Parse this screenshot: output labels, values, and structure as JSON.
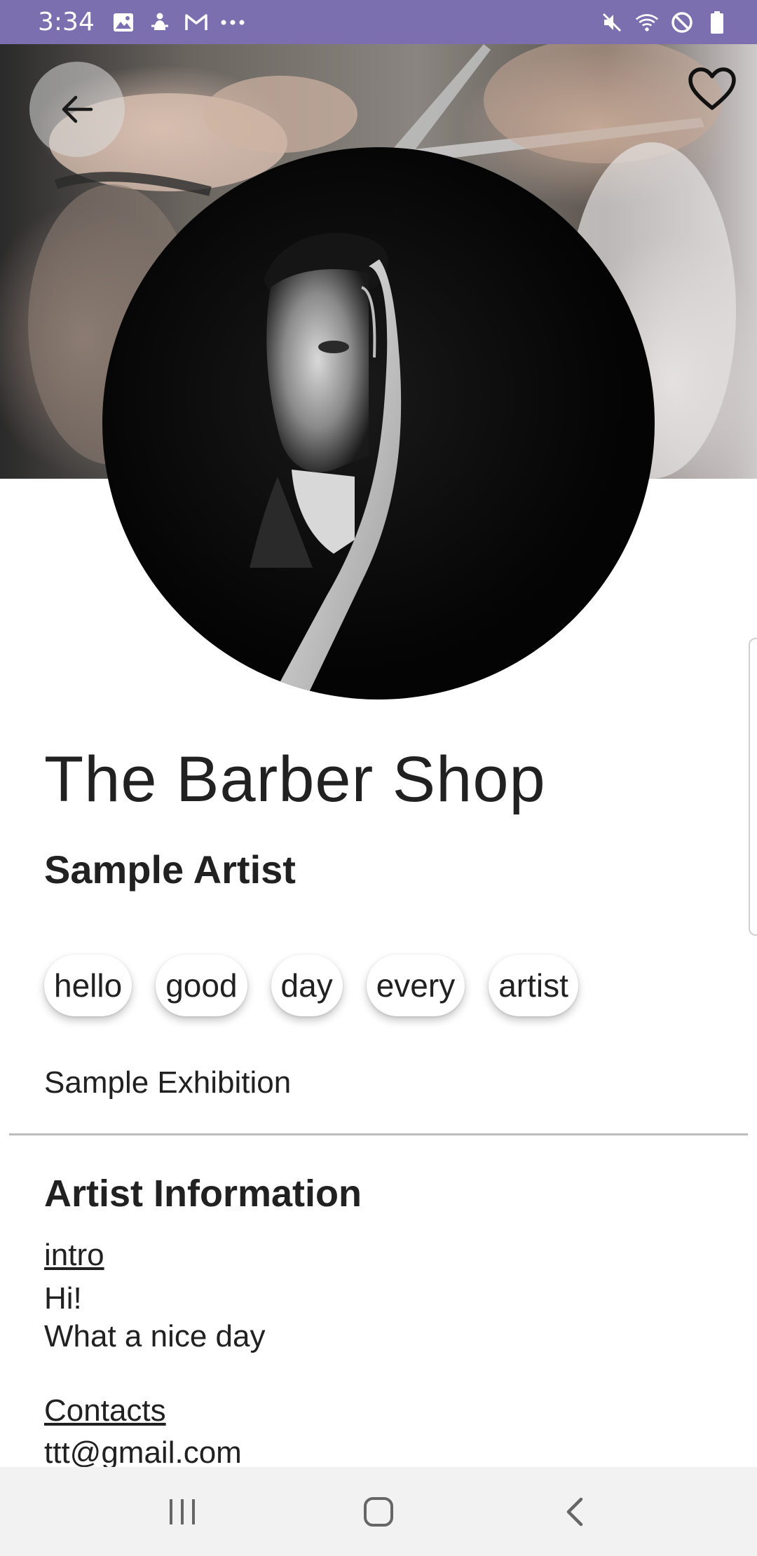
{
  "status_bar": {
    "time": "3:34",
    "left_icons": [
      "image-icon",
      "accessibility-icon",
      "gmail-icon",
      "more-dots-icon"
    ],
    "right_icons": [
      "mute-icon",
      "wifi-icon",
      "do-not-disturb-icon",
      "battery-icon"
    ],
    "color": "#7b6fb0"
  },
  "header": {
    "back_icon": "arrow-left-icon",
    "favorite_icon": "heart-outline-icon"
  },
  "profile": {
    "shop_name": "The Barber Shop",
    "artist_name": "Sample Artist",
    "tags": [
      "hello",
      "good",
      "day",
      "every",
      "artist"
    ],
    "exhibition": "Sample Exhibition"
  },
  "artist_info": {
    "section_title": "Artist Information",
    "intro_label": "intro",
    "intro_line1": "Hi!",
    "intro_line2": "What a nice day",
    "contacts_label": "Contacts",
    "contact_email": "ttt@gmail.com"
  },
  "nav_bar": {
    "icons": [
      "recent-apps-icon",
      "home-icon",
      "back-icon"
    ]
  }
}
